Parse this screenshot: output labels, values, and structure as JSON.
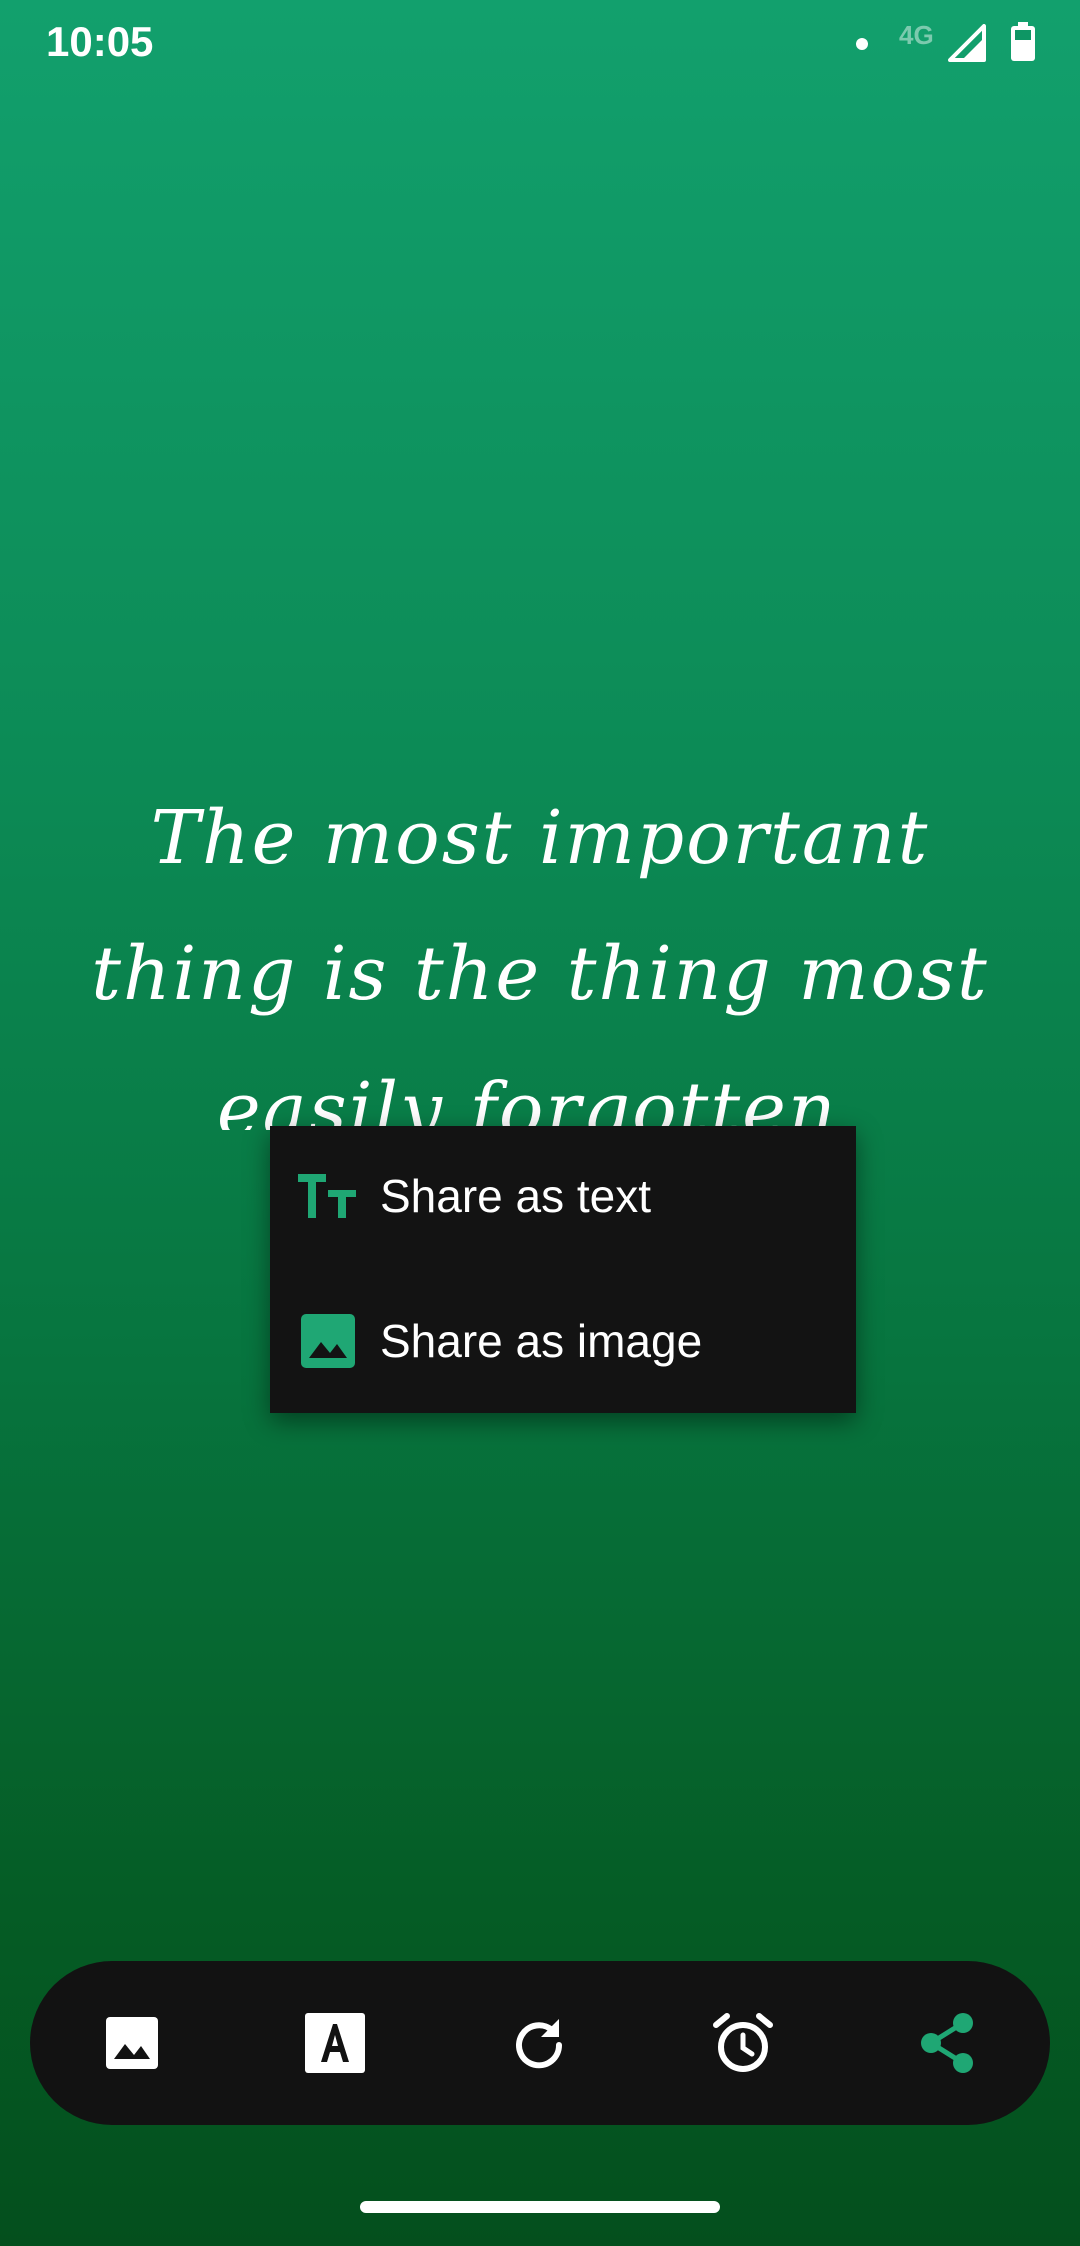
{
  "status_bar": {
    "time": "10:05",
    "network": "4G"
  },
  "quote": {
    "text": "The most important thing is the thing most easily forgotten."
  },
  "share_menu": {
    "items": [
      {
        "label": "Share as text",
        "icon": "text-format-icon"
      },
      {
        "label": "Share as image",
        "icon": "image-icon"
      }
    ]
  },
  "toolbar": {
    "buttons": [
      {
        "name": "background-image",
        "icon": "image-icon"
      },
      {
        "name": "font",
        "icon": "font-icon"
      },
      {
        "name": "refresh",
        "icon": "refresh-icon"
      },
      {
        "name": "reminder",
        "icon": "alarm-icon"
      },
      {
        "name": "share",
        "icon": "share-icon",
        "active": true
      }
    ]
  },
  "colors": {
    "accent": "#1fa774",
    "menu_bg": "#131313",
    "toolbar_bg": "#121212"
  }
}
